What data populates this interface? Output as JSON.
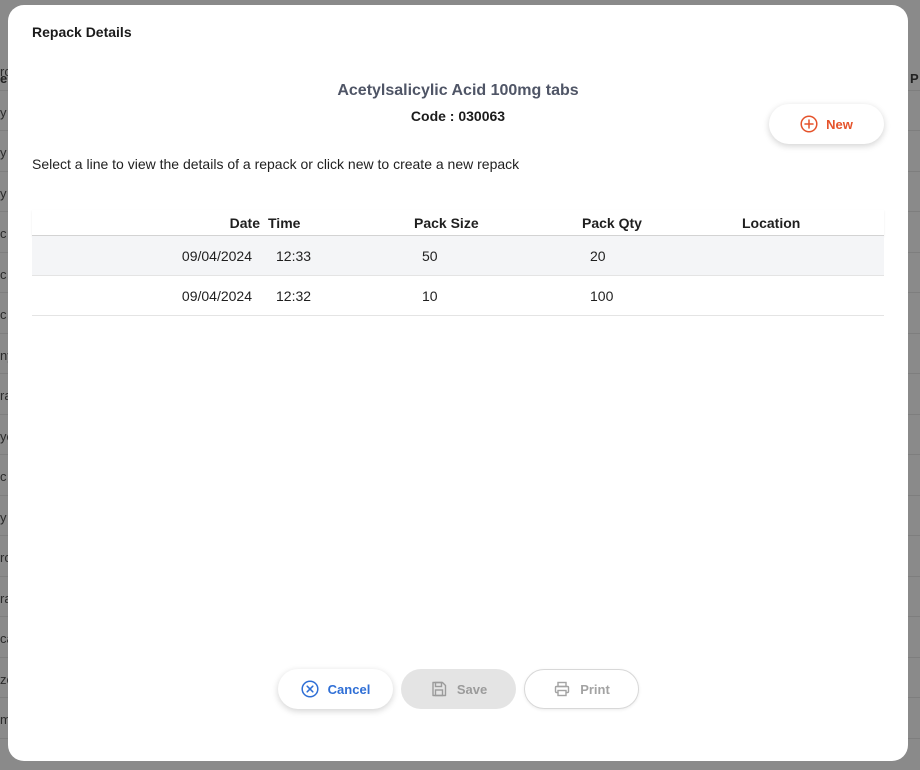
{
  "background": {
    "header_left": "e",
    "header_right": "P",
    "row_fragments": [
      "rc",
      "y",
      "y",
      "y",
      "c",
      "c",
      "c",
      "ny",
      "ra",
      "yc",
      "c",
      "y",
      "rc",
      "ra",
      "ca",
      "zc",
      "m"
    ]
  },
  "modal": {
    "title": "Repack Details",
    "item_name": "Acetylsalicylic Acid 100mg tabs",
    "code_label": "Code : ",
    "code_value": "030063",
    "new_button_label": "New",
    "instructions": "Select a line to view the details of a repack or click new to create a new repack"
  },
  "table": {
    "columns": {
      "date": "Date",
      "time": "Time",
      "pack_size": "Pack Size",
      "pack_qty": "Pack Qty",
      "location": "Location"
    },
    "rows": [
      {
        "date": "09/04/2024",
        "time": "12:33",
        "pack_size": "50",
        "pack_qty": "20",
        "location": ""
      },
      {
        "date": "09/04/2024",
        "time": "12:32",
        "pack_size": "10",
        "pack_qty": "100",
        "location": ""
      }
    ]
  },
  "footer": {
    "cancel_label": "Cancel",
    "save_label": "Save",
    "print_label": "Print"
  },
  "colors": {
    "accent_new": "#e5532b",
    "accent_cancel": "#2f6fd6",
    "disabled_text": "#9b9b9b"
  },
  "icons": {
    "new": "plus-circle-icon",
    "cancel": "x-circle-icon",
    "save": "floppy-disk-icon",
    "print": "printer-icon"
  }
}
